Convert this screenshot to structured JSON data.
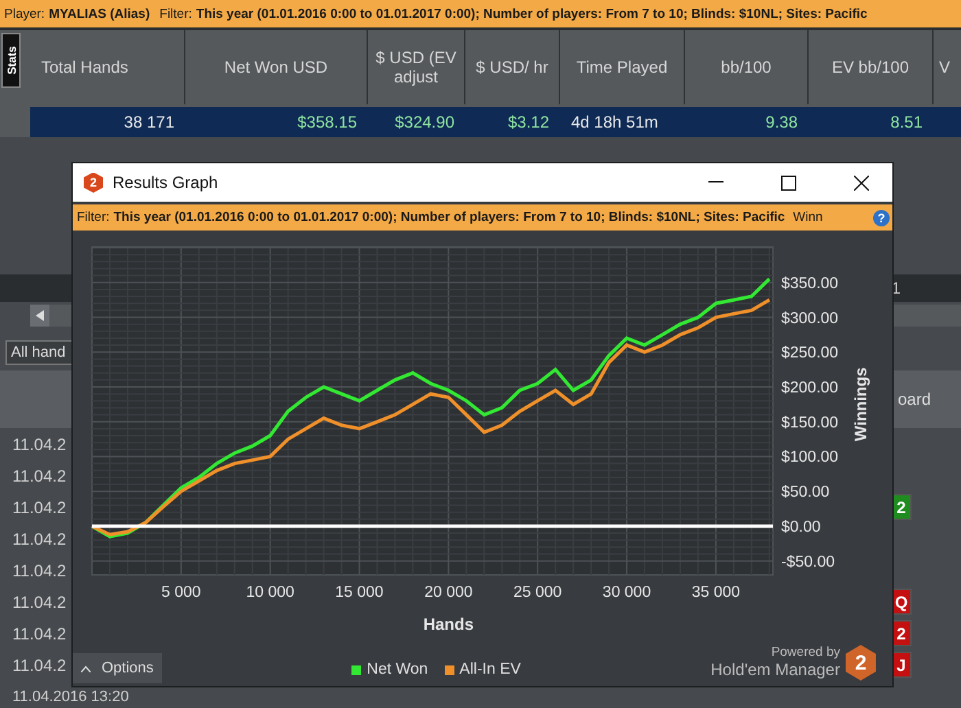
{
  "player_bar": {
    "player_label": "Player:",
    "player": "MYALIAS (Alias)",
    "filter_label": "Filter:",
    "filter": "This year (01.01.2016 0:00 to 01.01.2017 0:00); Number of players: From 7 to 10; Blinds: $10NL; Sites: Pacific"
  },
  "side_tab": {
    "label": "Stats"
  },
  "stats_table": {
    "columns": [
      "Total Hands",
      "Net Won USD",
      "$ USD (EV adjust",
      "$ USD/ hr",
      "Time Played",
      "bb/100",
      "EV bb/100",
      "V"
    ],
    "rows": [
      {
        "selected": true,
        "cells": [
          "38 171",
          "$358.15",
          "$324.90",
          "$3.12",
          "4d 18h 51m",
          "9.38",
          "8.51"
        ]
      }
    ]
  },
  "lower_panel": {
    "page_number": "1",
    "hands_dropdown": "All hand",
    "column_header": "oard",
    "rows": [
      {
        "date": "11.04.2"
      },
      {
        "date": "11.04.2"
      },
      {
        "date": "11.04.2",
        "card": {
          "rank": "2",
          "color": "#1f8c1f"
        }
      },
      {
        "date": "11.04.2"
      },
      {
        "date": "11.04.2"
      },
      {
        "date": "11.04.2",
        "card": {
          "rank": "Q",
          "color": "#c41010"
        }
      },
      {
        "date": "11.04.2",
        "card": {
          "rank": "2",
          "color": "#c41010"
        }
      },
      {
        "date": "11.04.2",
        "card": {
          "rank": "J",
          "color": "#c41010"
        }
      },
      {
        "date": "11.04.2016 13:20"
      }
    ]
  },
  "dialog": {
    "app_icon_text": "2",
    "title": "Results Graph",
    "filter_label": "Filter:",
    "filter": "This year (01.01.2016 0:00 to 01.01.2017 0:00); Number of players: From 7 to 10; Blinds: $10NL; Sites: Pacific",
    "filter_tail": "Winn",
    "help_icon": "?",
    "chart_data": {
      "type": "line",
      "xlabel": "Hands",
      "ylabel": "Winnings",
      "x": [
        0,
        1000,
        2000,
        3000,
        4000,
        5000,
        6000,
        7000,
        8000,
        9000,
        10000,
        11000,
        12000,
        13000,
        14000,
        15000,
        16000,
        17000,
        18000,
        19000,
        20000,
        21000,
        22000,
        23000,
        24000,
        25000,
        26000,
        27000,
        28000,
        29000,
        30000,
        31000,
        32000,
        33000,
        34000,
        35000,
        36000,
        37000,
        38000
      ],
      "series": [
        {
          "name": "Net Won",
          "color": "#33e833",
          "values": [
            0,
            -15,
            -10,
            5,
            30,
            55,
            70,
            90,
            105,
            115,
            130,
            165,
            185,
            200,
            190,
            180,
            195,
            210,
            220,
            205,
            195,
            180,
            160,
            170,
            195,
            205,
            225,
            195,
            210,
            245,
            270,
            260,
            275,
            290,
            300,
            320,
            325,
            330,
            355
          ]
        },
        {
          "name": "All-In EV",
          "color": "#f0902a",
          "values": [
            0,
            -12,
            -8,
            5,
            28,
            50,
            65,
            80,
            90,
            95,
            100,
            125,
            140,
            155,
            145,
            140,
            150,
            160,
            175,
            190,
            185,
            160,
            135,
            145,
            165,
            180,
            195,
            175,
            190,
            235,
            260,
            250,
            260,
            275,
            285,
            300,
            305,
            310,
            325
          ]
        }
      ],
      "grid": true,
      "xlim": [
        0,
        38200
      ],
      "ylim": [
        -70,
        401
      ],
      "xticks": [
        {
          "value": 5000,
          "label": "5 000"
        },
        {
          "value": 10000,
          "label": "10 000"
        },
        {
          "value": 15000,
          "label": "15 000"
        },
        {
          "value": 20000,
          "label": "20 000"
        },
        {
          "value": 25000,
          "label": "25 000"
        },
        {
          "value": 30000,
          "label": "30 000"
        },
        {
          "value": 35000,
          "label": "35 000"
        }
      ],
      "yticks": [
        {
          "value": -50,
          "label": "-$50.00"
        },
        {
          "value": 0,
          "label": "$0.00"
        },
        {
          "value": 50,
          "label": "$50.00"
        },
        {
          "value": 100,
          "label": "$100.00"
        },
        {
          "value": 150,
          "label": "$150.00"
        },
        {
          "value": 200,
          "label": "$200.00"
        },
        {
          "value": 250,
          "label": "$250.00"
        },
        {
          "value": 300,
          "label": "$300.00"
        },
        {
          "value": 350,
          "label": "$350.00"
        }
      ]
    },
    "options_button": "Options",
    "powered_by": "Powered by",
    "brand": "Hold'em Manager",
    "logo_text": "2"
  }
}
